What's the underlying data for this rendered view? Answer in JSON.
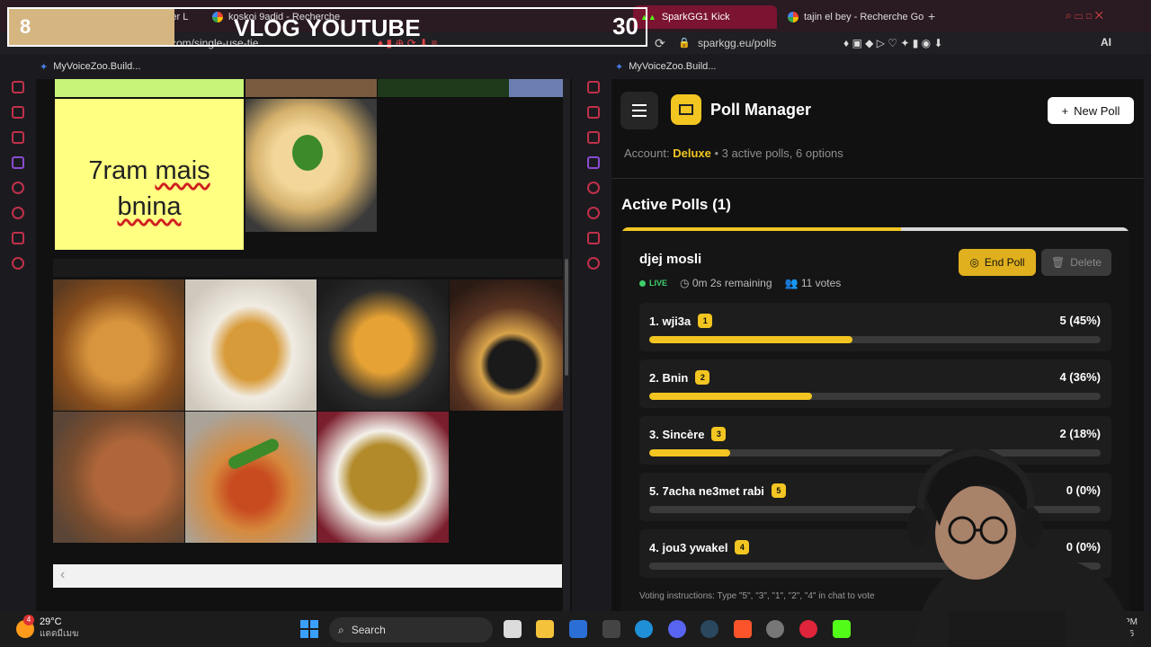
{
  "overlay": {
    "left_number": "8",
    "title": "VLOG YOUTUBE",
    "right_number": "30"
  },
  "left_browser": {
    "tabs": [
      {
        "label": "ier L"
      },
      {
        "label": "koskoi 9adid - Recherche"
      }
    ],
    "url": "com/single-use-tie",
    "bookmark": "MyVoiceZoo.Build..."
  },
  "right_browser": {
    "tabs": [
      {
        "label": "SparkGG1 Kick"
      },
      {
        "label": "tajin el bey - Recherche Go"
      }
    ],
    "url": "sparkgg.eu/polls",
    "bookmark": "MyVoiceZoo.Build...",
    "ai_label": "AI"
  },
  "sticky_note": {
    "line1": "7ram mais",
    "line2": "bnina"
  },
  "poll_manager": {
    "title": "Poll Manager",
    "new_poll_label": "New Poll",
    "account_prefix": "Account:",
    "account_tier": "Deluxe",
    "account_stats": "3 active polls, 6 options",
    "active_heading": "Active Polls (1)",
    "poll": {
      "name": "djej mosli",
      "status": "LIVE",
      "time_remaining": "0m 2s remaining",
      "votes": "11 votes",
      "end_label": "End Poll",
      "delete_label": "Delete",
      "time_progress": 0.55,
      "options": [
        {
          "label": "1. wji3a",
          "badge": "1",
          "result": "5 (45%)",
          "share": 0.45
        },
        {
          "label": "2. Bnin",
          "badge": "2",
          "result": "4 (36%)",
          "share": 0.36
        },
        {
          "label": "3. Sincère",
          "badge": "3",
          "result": "2 (18%)",
          "share": 0.18
        },
        {
          "label": "5. 7acha ne3met rabi",
          "badge": "5",
          "result": "0 (0%)",
          "share": 0
        },
        {
          "label": "4. jou3 ywakel",
          "badge": "4",
          "result": "0 (0%)",
          "share": 0
        }
      ],
      "instructions": "Voting instructions: Type \"5\", \"3\", \"1\", \"2\", \"4\" in chat to vote"
    }
  },
  "taskbar": {
    "temperature": "29°C",
    "weather_sub": "แดดมีเมฆ",
    "weather_badge": "4",
    "search_label": "Search",
    "clock_line1": "PM",
    "clock_line2": "26"
  },
  "colors": {
    "accent": "#f2c521",
    "live": "#3fce6b",
    "opera_red": "#c0304a"
  }
}
